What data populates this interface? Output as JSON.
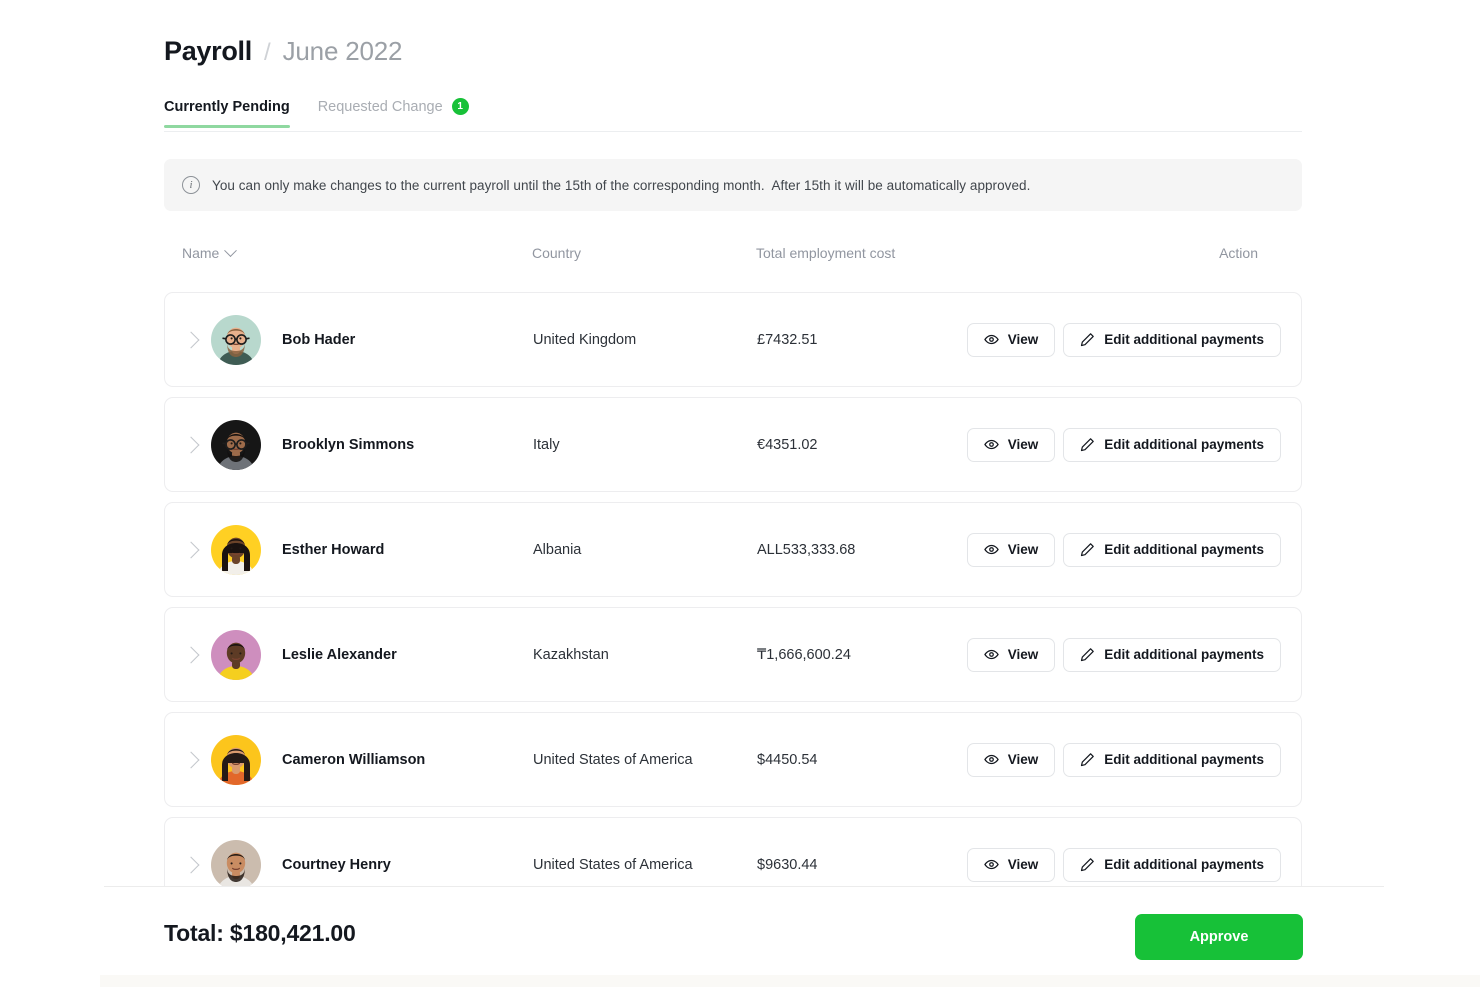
{
  "breadcrumb": {
    "main": "Payroll",
    "separator": "/",
    "sub": "June 2022"
  },
  "tabs": [
    {
      "label": "Currently Pending",
      "active": true,
      "badge": null
    },
    {
      "label": "Requested Change",
      "active": false,
      "badge": "1"
    }
  ],
  "banner": {
    "icon": "info-icon",
    "text": "You can only make changes to the current payroll until the 15th of the corresponding month.  After 15th it will be automatically approved."
  },
  "table": {
    "headers": {
      "name": "Name",
      "country": "Country",
      "cost": "Total employment cost",
      "action": "Action"
    },
    "sort_icon": "chevron-down-icon",
    "rows": [
      {
        "name": "Bob Hader",
        "country": "United Kingdom",
        "cost": "£7432.51",
        "avatar": {
          "bg": "#b8d8cd",
          "skin": "#e8b08c",
          "hair": "#8a6240",
          "shirt": "#3f5c54",
          "glasses": true,
          "beard": true,
          "long_hair": false
        }
      },
      {
        "name": "Brooklyn Simmons",
        "country": "Italy",
        "cost": "€4351.02",
        "avatar": {
          "bg": "#161616",
          "skin": "#9d6b4a",
          "hair": "#120f0e",
          "shirt": "#6e7278",
          "glasses": true,
          "beard": true,
          "long_hair": false
        }
      },
      {
        "name": "Esther Howard",
        "country": "Albania",
        "cost": "ALL533,333.68",
        "avatar": {
          "bg": "#ffd023",
          "skin": "#6b4329",
          "hair": "#1a1210",
          "shirt": "#f2efe9",
          "glasses": false,
          "beard": false,
          "long_hair": true
        }
      },
      {
        "name": "Leslie Alexander",
        "country": "Kazakhstan",
        "cost": "₸1,666,600.24",
        "avatar": {
          "bg": "#ce8ebe",
          "skin": "#5d3b25",
          "hair": "#161110",
          "shirt": "#f5cf1f",
          "glasses": false,
          "beard": false,
          "long_hair": false
        }
      },
      {
        "name": "Cameron Williamson",
        "country": "United States of America",
        "cost": "$4450.54",
        "avatar": {
          "bg": "#fcc51c",
          "skin": "#d99a6e",
          "hair": "#241a16",
          "shirt": "#e2672a",
          "glasses": false,
          "beard": false,
          "long_hair": true
        }
      },
      {
        "name": "Courtney Henry",
        "country": "United States of America",
        "cost": "$9630.44",
        "avatar": {
          "bg": "#cbbcae",
          "skin": "#c98c62",
          "hair": "#241a14",
          "shirt": "#e9e6e2",
          "glasses": false,
          "beard": true,
          "long_hair": false
        }
      }
    ],
    "row_buttons": {
      "view": {
        "label": "View",
        "icon": "eye-icon"
      },
      "edit": {
        "label": "Edit additional payments",
        "icon": "pencil-icon"
      }
    },
    "expand_icon": "chevron-right-icon"
  },
  "footer": {
    "total": "Total: $180,421.00",
    "approve_label": "Approve"
  },
  "colors": {
    "accent_green": "#17c138",
    "tab_underline": "#8fd8a0",
    "banner_bg": "#f5f5f5",
    "border": "#ededef",
    "text_primary": "#14181f",
    "text_muted": "#9196a0"
  }
}
